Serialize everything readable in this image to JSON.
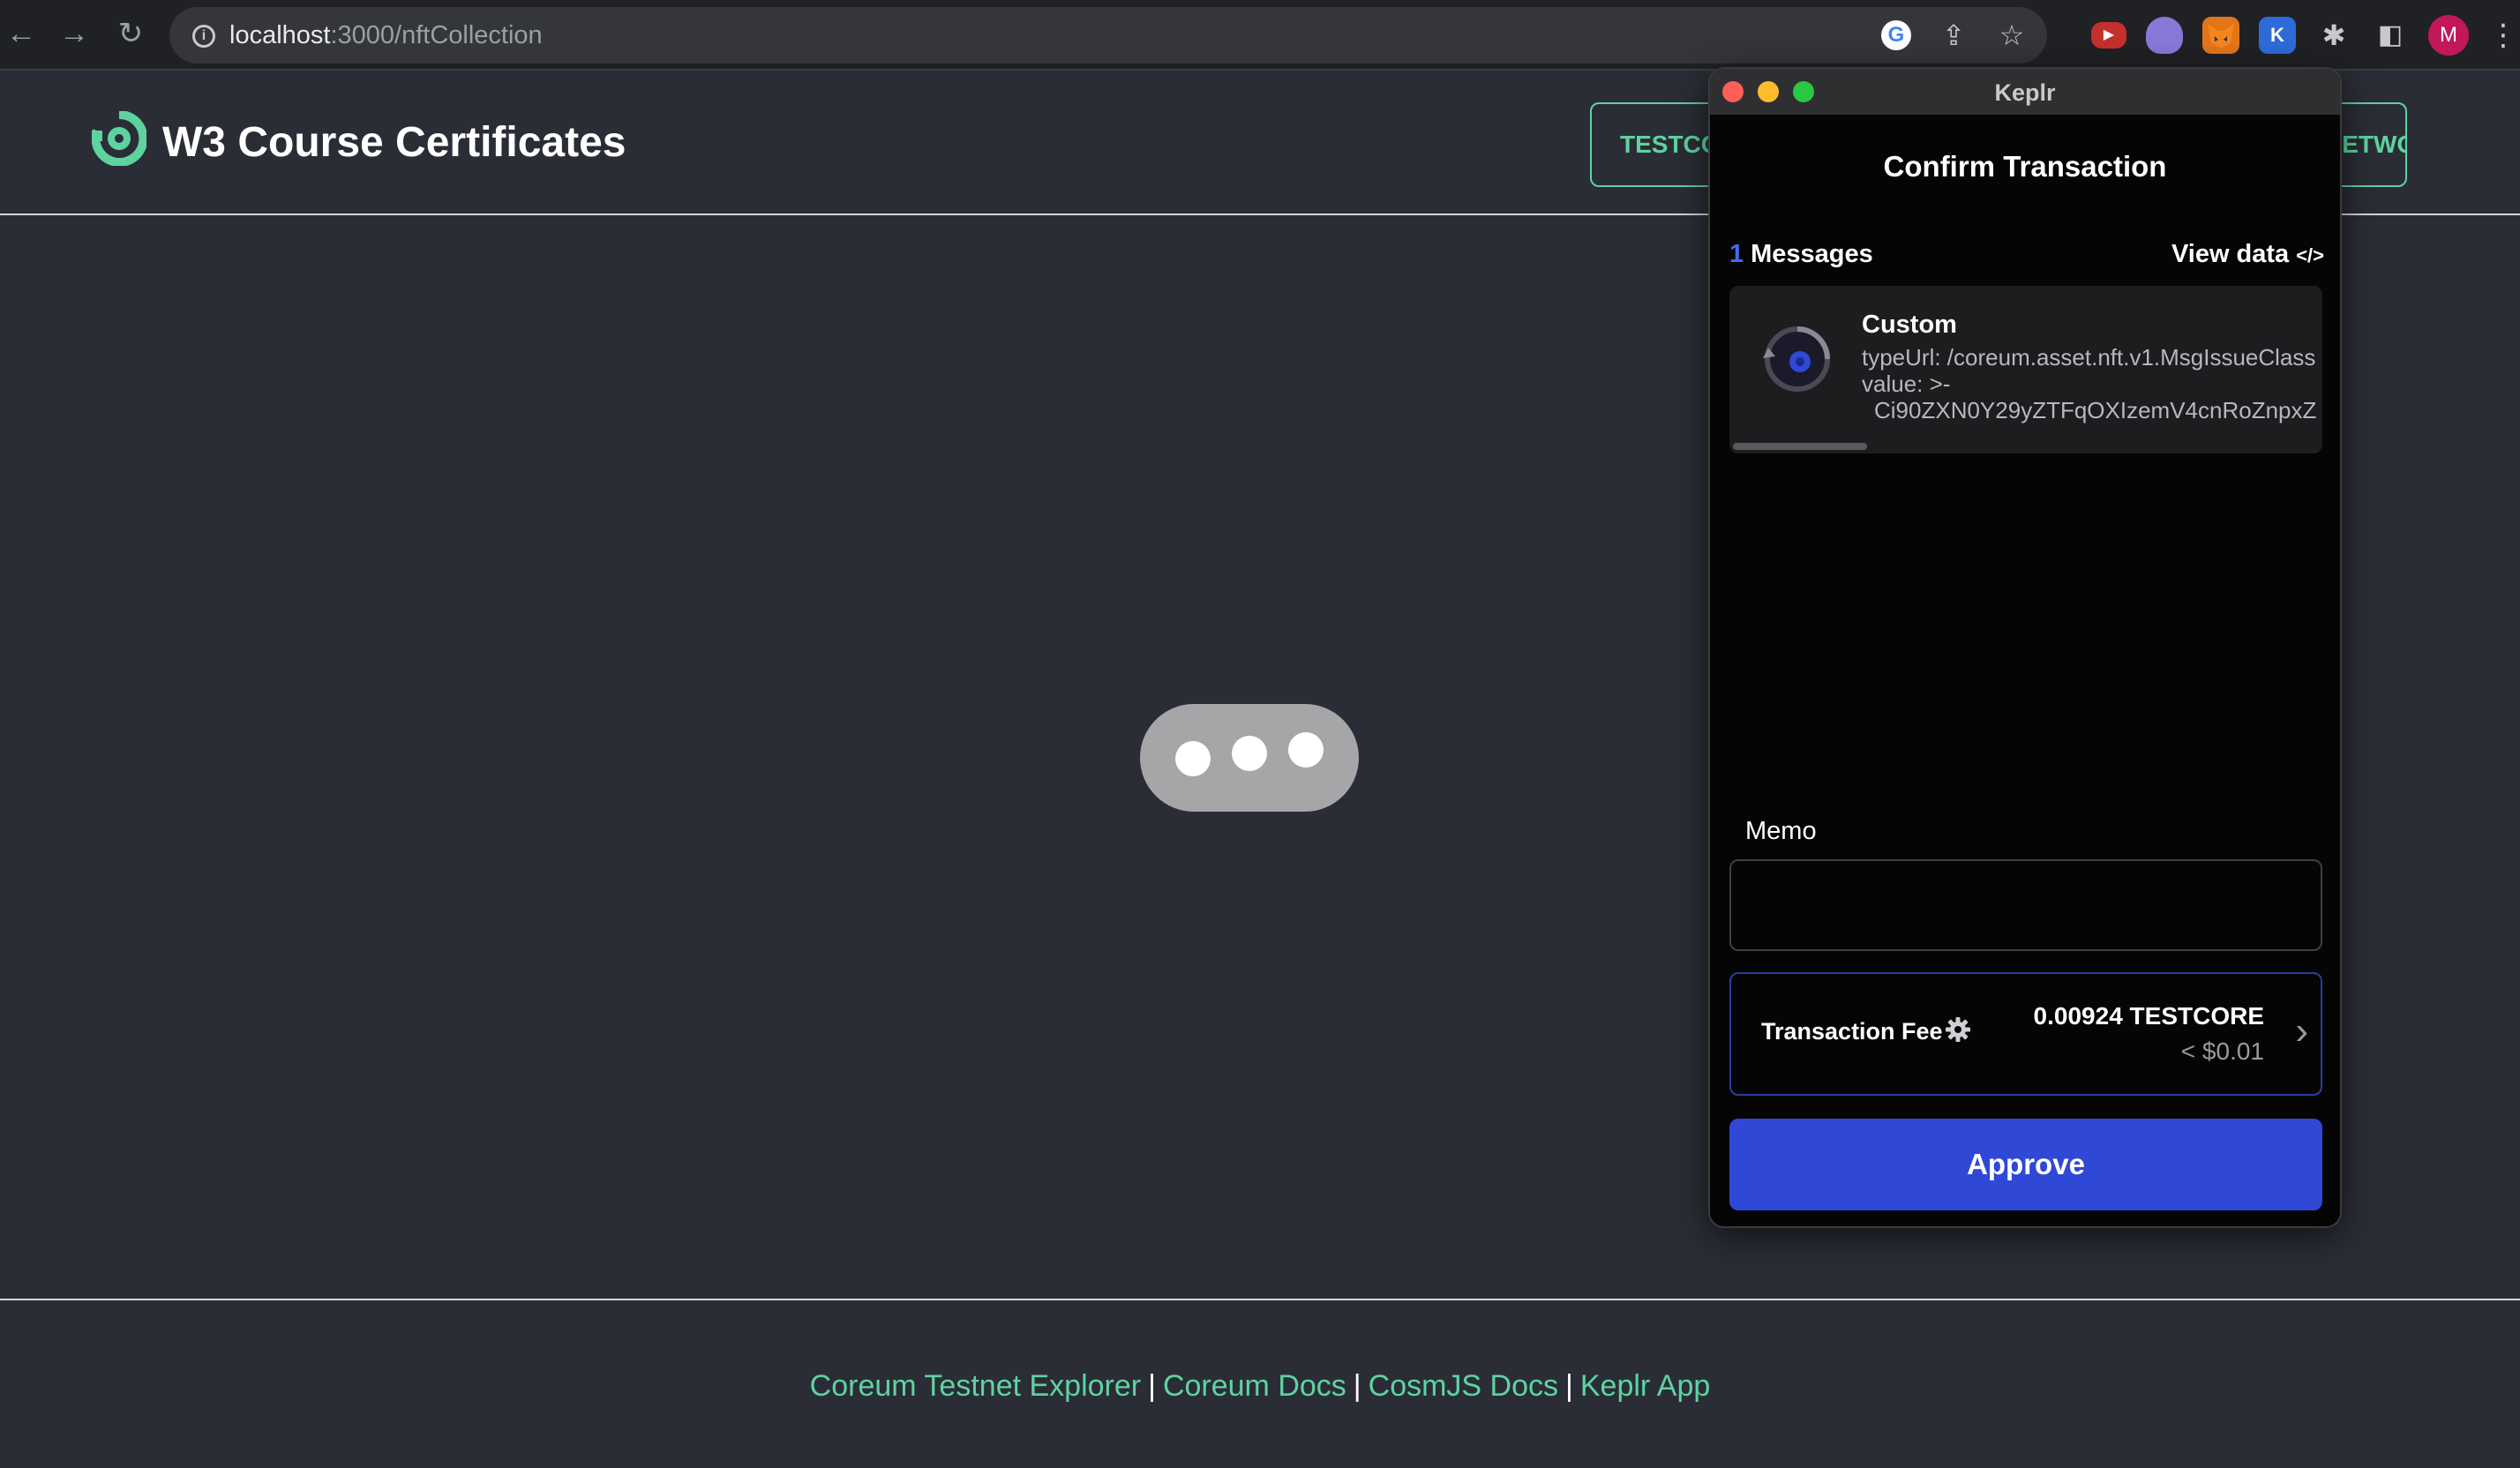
{
  "browser": {
    "url_host": "localhost",
    "url_path": ":3000/nftCollection",
    "back_icon": "←",
    "forward_icon": "→",
    "reload_icon": "↻",
    "share_icon": "⇪",
    "star_icon": "☆",
    "google_icon": "G",
    "extensions": {
      "youtube": "▶",
      "k_label": "K",
      "puzzle": "✱",
      "sidepanel": "◧"
    },
    "profile_initial": "M",
    "menu_icon": "⋮"
  },
  "app": {
    "title": "W3 Course Certificates",
    "brand_color": "#5ed3a1",
    "header_buttons": {
      "testcore": "TESTCORE",
      "network": "NETWORK"
    }
  },
  "footer": {
    "links": [
      "Coreum Testnet Explorer",
      "Coreum Docs",
      "CosmJS Docs",
      "Keplr App"
    ],
    "separator": "|"
  },
  "keplr": {
    "window_title": "Keplr",
    "heading": "Confirm Transaction",
    "messages_count": "1",
    "messages_label": "Messages",
    "view_data_label": "View data",
    "view_data_icon": "</>",
    "message": {
      "title": "Custom",
      "type_line": "typeUrl: /coreum.asset.nft.v1.MsgIssueClass",
      "value_line": "value: >-",
      "value_data": "Ci90ZXN0Y29yZTFqOXIzemV4cnRoZnpxZ"
    },
    "memo_label": "Memo",
    "memo_value": "",
    "fee": {
      "label": "Transaction Fee",
      "amount": "0.00924 TESTCORE",
      "usd": "< $0.01",
      "chevron": "›"
    },
    "approve_label": "Approve",
    "accent_color": "#2f48d6"
  }
}
